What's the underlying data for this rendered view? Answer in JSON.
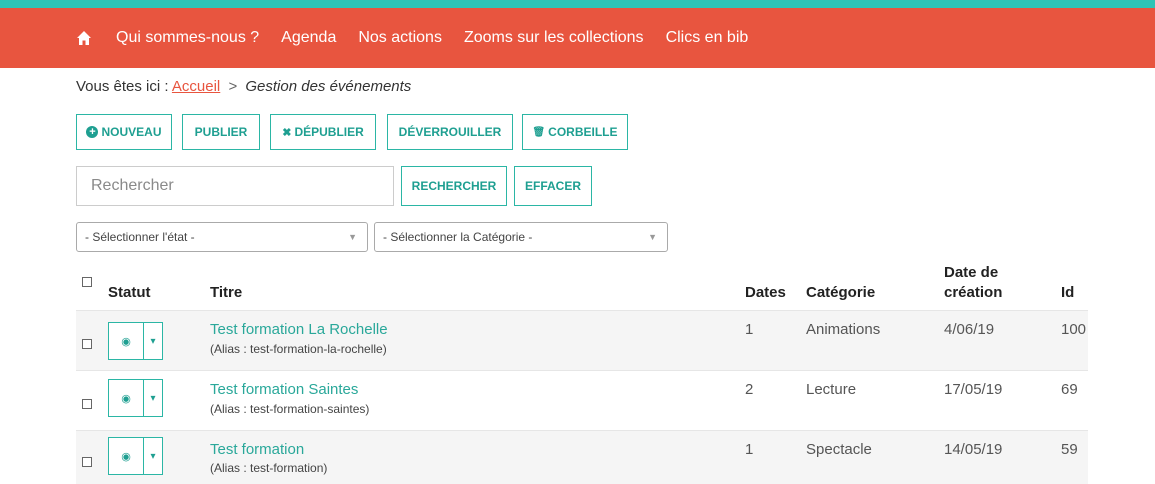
{
  "nav": {
    "home_icon": "home-icon",
    "items": [
      "Qui sommes-nous ?",
      "Agenda",
      "Nos actions",
      "Zooms sur les collections",
      "Clics en bib"
    ]
  },
  "breadcrumb": {
    "prefix": "Vous êtes ici :",
    "home": "Accueil",
    "separator": ">",
    "current": "Gestion des événements"
  },
  "toolbar": {
    "new_icon": "+",
    "new_label": "NOUVEAU",
    "publish_label": "PUBLIER",
    "unpublish_icon": "✖",
    "unpublish_label": "DÉPUBLIER",
    "unlock_label": "DÉVERROUILLER",
    "trash_icon": "🗑",
    "trash_label": "CORBEILLE"
  },
  "search": {
    "placeholder": "Rechercher",
    "search_label": "RECHERCHER",
    "clear_label": "EFFACER"
  },
  "filters": {
    "state": "- Sélectionner l'état -",
    "category": "- Sélectionner la Catégorie -"
  },
  "table": {
    "headers": {
      "status": "Statut",
      "title": "Titre",
      "dates": "Dates",
      "category": "Catégorie",
      "created_line1": "Date de",
      "created_line2": "création",
      "id": "Id"
    },
    "rows": [
      {
        "title": "Test formation La Rochelle",
        "alias": "(Alias : test-formation-la-rochelle)",
        "dates": "1",
        "category": "Animations",
        "created": "4/06/19",
        "id": "100"
      },
      {
        "title": "Test formation Saintes",
        "alias": "(Alias : test-formation-saintes)",
        "dates": "2",
        "category": "Lecture",
        "created": "17/05/19",
        "id": "69"
      },
      {
        "title": "Test formation",
        "alias": "(Alias : test-formation)",
        "dates": "1",
        "category": "Spectacle",
        "created": "14/05/19",
        "id": "59"
      }
    ]
  },
  "colors": {
    "brand": "#e8553f",
    "accent": "#2bb6a5"
  }
}
